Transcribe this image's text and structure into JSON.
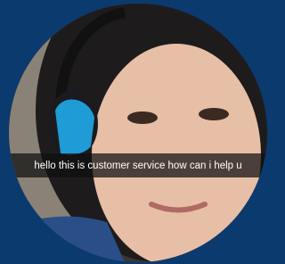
{
  "video_call": {
    "caption": "hello this is customer service how can i help u"
  },
  "colors": {
    "background": "#0b3a6e",
    "caption_bar": "#0f0f0f",
    "headset_accent": "#1f9bd6"
  },
  "icons": {
    "headset": "headset-icon"
  }
}
